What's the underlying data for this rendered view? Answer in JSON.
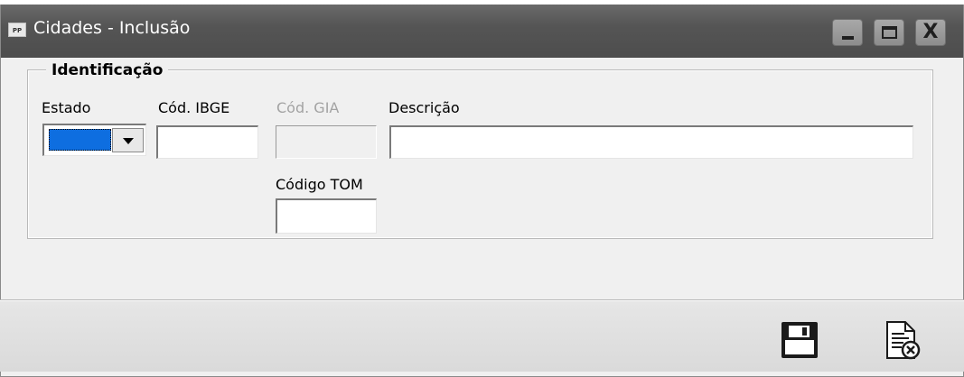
{
  "window": {
    "icon_text": "PP",
    "title": "Cidades - Inclusão",
    "minimize_label": "",
    "maximize_label": "",
    "close_label": "X"
  },
  "group": {
    "legend": "Identificação",
    "fields": {
      "estado": {
        "label": "Estado",
        "value": ""
      },
      "cod_ibge": {
        "label": "Cód. IBGE",
        "value": ""
      },
      "cod_gia": {
        "label": "Cód. GIA",
        "value": "",
        "disabled": true
      },
      "descricao": {
        "label": "Descrição",
        "value": ""
      },
      "codigo_tom": {
        "label": "Código TOM",
        "value": ""
      }
    }
  },
  "toolbar": {
    "icons": [
      "save-icon",
      "cancel-document-icon"
    ]
  },
  "colors": {
    "titlebar": "#555555",
    "selection": "#0e6ee0",
    "disabled_text": "#a3a3a3",
    "window_bg": "#f0f0f0"
  }
}
